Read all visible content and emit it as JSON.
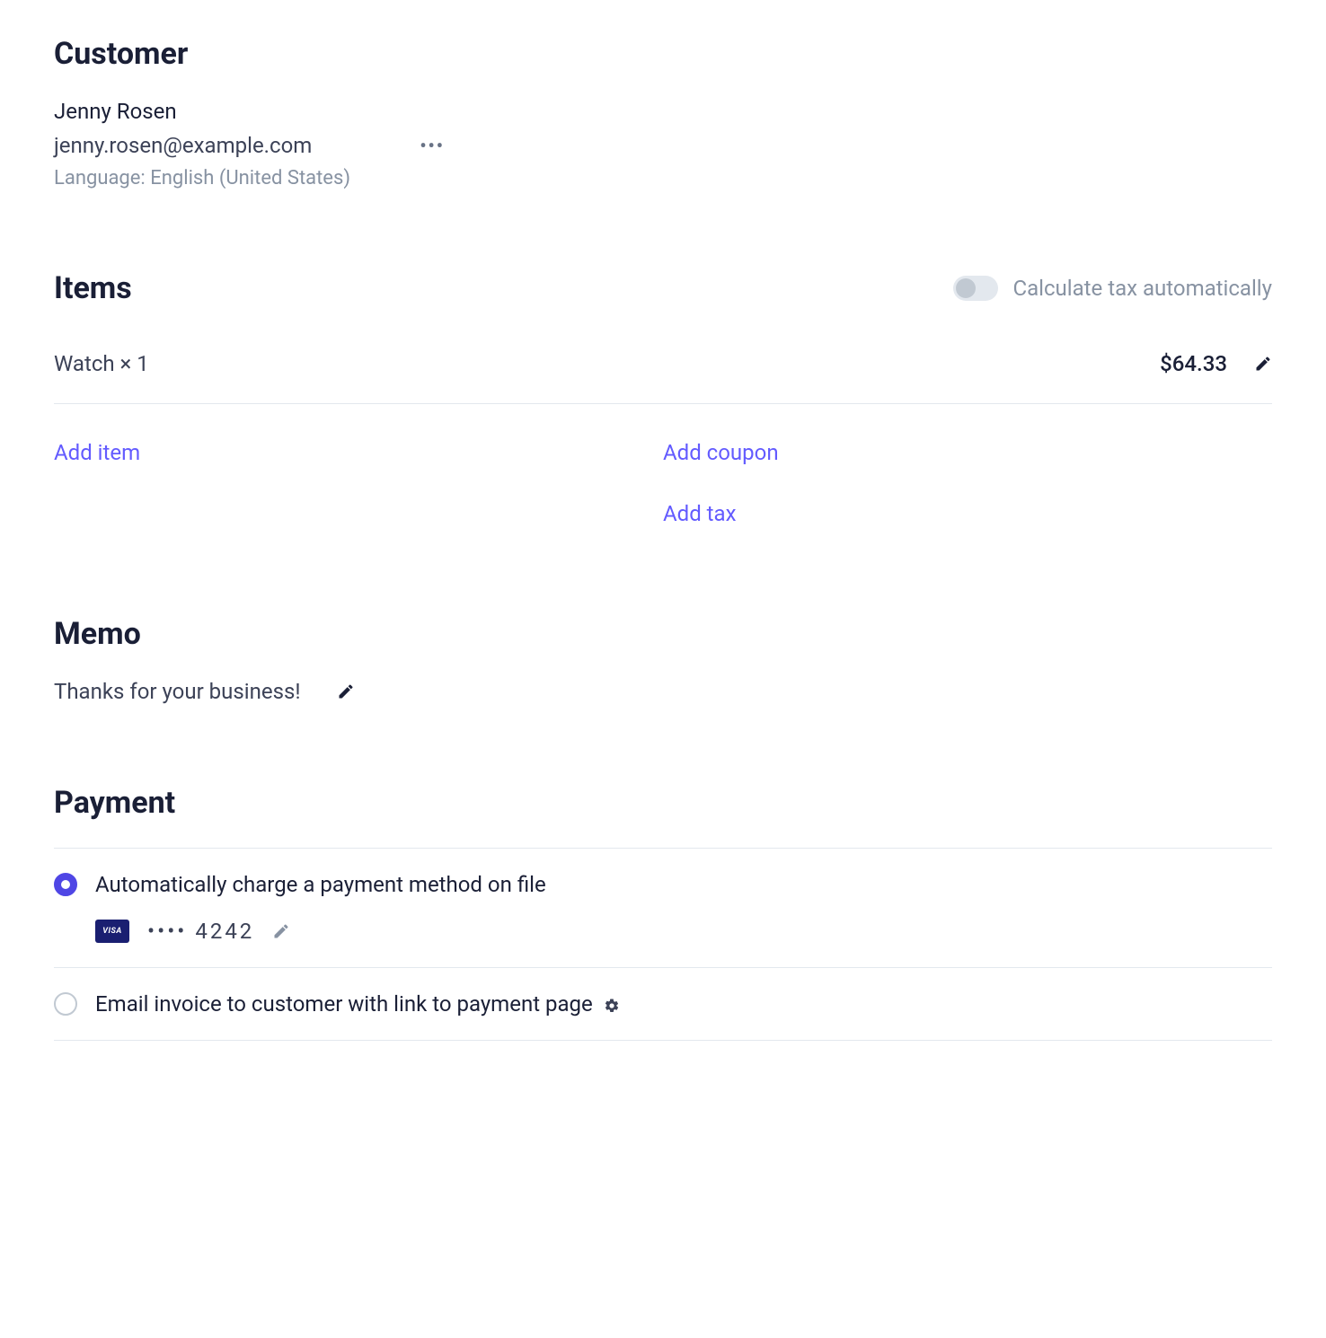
{
  "customer": {
    "section_title": "Customer",
    "name": "Jenny Rosen",
    "email": "jenny.rosen@example.com",
    "language_line": "Language: English (United States)"
  },
  "items": {
    "section_title": "Items",
    "tax_toggle_label": "Calculate tax automatically",
    "tax_toggle_on": false,
    "line_items": [
      {
        "description": "Watch × 1",
        "price": "$64.33"
      }
    ],
    "add_item_label": "Add item",
    "add_coupon_label": "Add coupon",
    "add_tax_label": "Add tax"
  },
  "memo": {
    "section_title": "Memo",
    "text": "Thanks for your business!"
  },
  "payment": {
    "section_title": "Payment",
    "options": [
      {
        "label": "Automatically charge a payment method on file",
        "selected": true,
        "card": {
          "brand": "VISA",
          "last4_display": "•••• 4242"
        }
      },
      {
        "label": "Email invoice to customer with link to payment page",
        "selected": false,
        "has_settings": true
      }
    ]
  }
}
